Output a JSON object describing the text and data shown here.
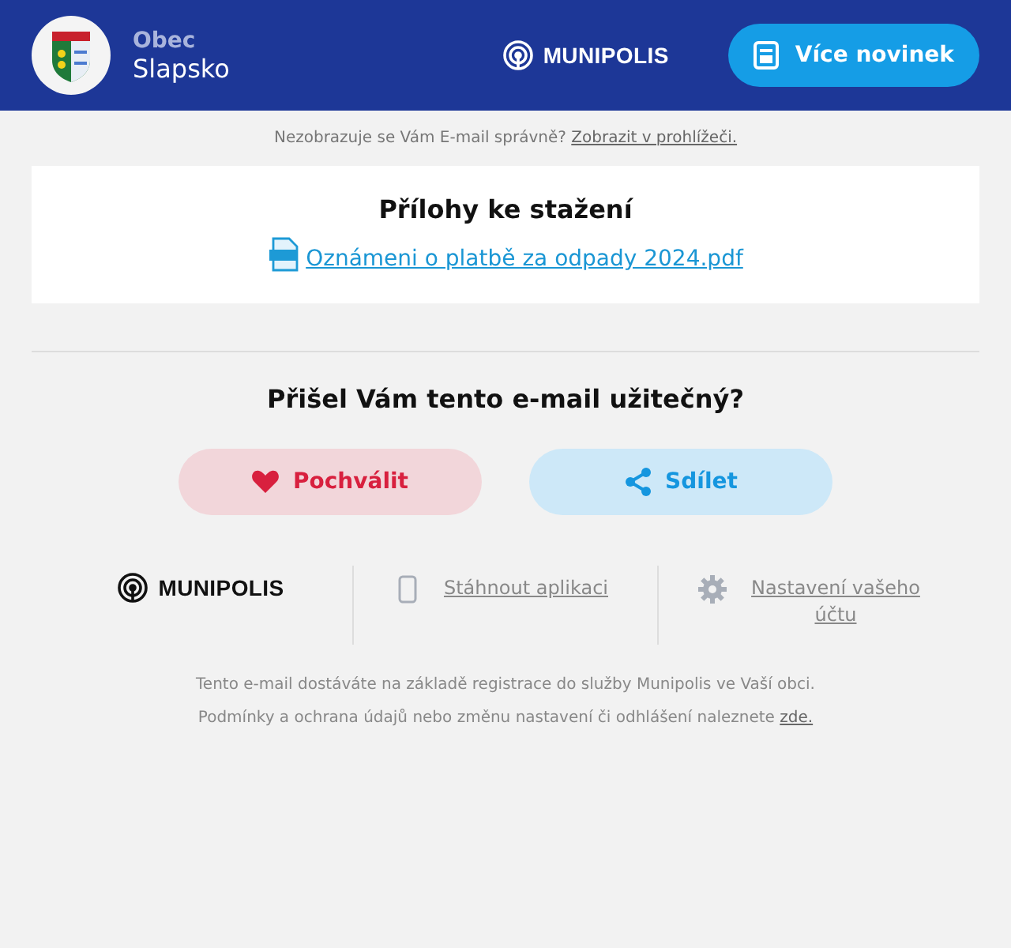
{
  "header": {
    "org_label": "Obec",
    "org_name": "Slapsko",
    "brand": "MUNIPOLIS",
    "button": "Více novinek"
  },
  "notice": {
    "text": "Nezobrazuje se Vám E-mail správně?",
    "link": "Zobrazit v prohlížeči."
  },
  "attachments": {
    "title": "Přílohy ke stažení",
    "files": [
      {
        "name": "Oznámeni o platbě za odpady 2024.pdf"
      }
    ]
  },
  "feedback": {
    "question": "Přišel Vám tento e-mail užitečný?",
    "buttons": [
      {
        "kind": "like",
        "label": "Pochválit"
      },
      {
        "kind": "share",
        "label": "Sdílet"
      }
    ]
  },
  "footer": {
    "brand": "MUNIPOLIS",
    "links": [
      {
        "kind": "app",
        "label": "Stáhnout aplikaci"
      },
      {
        "kind": "settings",
        "label": "Nastavení vašeho účtu"
      }
    ],
    "line1": "Tento e-mail dostáváte na základě registrace do služby Munipolis ve Vaší obci.",
    "line2": {
      "text": "Podmínky a ochrana údajů nebo změnu nastavení či odhlášení naleznete",
      "link": "zde."
    }
  }
}
